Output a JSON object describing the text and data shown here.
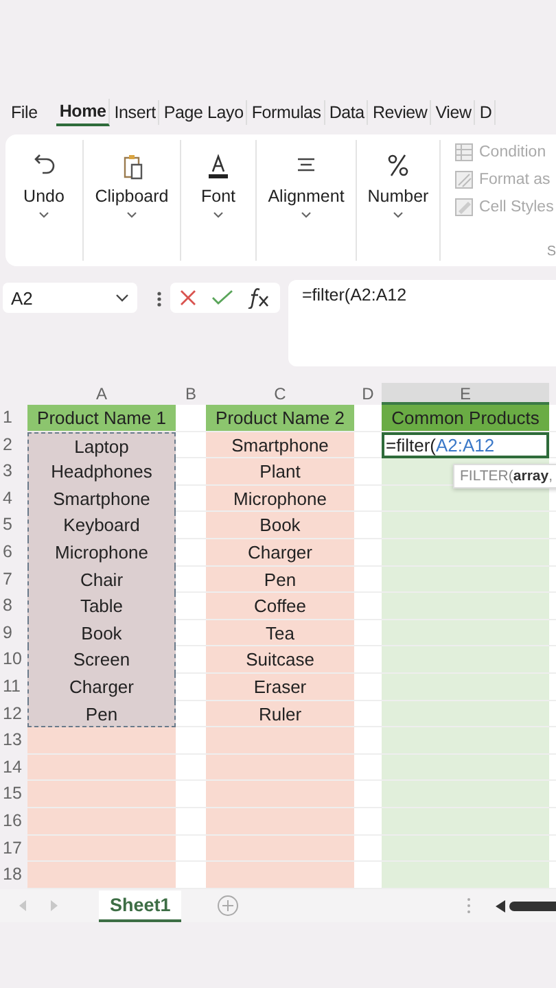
{
  "ribbon_tabs": [
    {
      "label": "File",
      "selected": false
    },
    {
      "label": "Home",
      "selected": true
    },
    {
      "label": "Insert",
      "selected": false
    },
    {
      "label": "Page Layo",
      "selected": false
    },
    {
      "label": "Formulas",
      "selected": false
    },
    {
      "label": "Data",
      "selected": false
    },
    {
      "label": "Review",
      "selected": false
    },
    {
      "label": "View",
      "selected": false
    },
    {
      "label": "D",
      "selected": false
    }
  ],
  "ribbon_groups": [
    {
      "kind": "undo",
      "label": "Undo"
    },
    {
      "kind": "clipboard",
      "label": "Clipboard"
    },
    {
      "kind": "font",
      "label": "Font"
    },
    {
      "kind": "alignment",
      "label": "Alignment"
    },
    {
      "kind": "number",
      "label": "Number"
    }
  ],
  "styles_group": {
    "items": [
      {
        "kind": "conditional",
        "label": "Condition"
      },
      {
        "kind": "table",
        "label": "Format as"
      },
      {
        "kind": "cellstyles",
        "label": "Cell Styles"
      }
    ],
    "group_label": "S"
  },
  "formula_bar": {
    "name_box": "A2",
    "formula": "=filter(A2:A12"
  },
  "sheet": {
    "columns": [
      {
        "letter": "A",
        "kind": "input",
        "selected": false,
        "marquee": true,
        "cells": [
          "Product Name 1",
          "Laptop",
          "Headphones",
          "Smartphone",
          "Keyboard",
          "Microphone",
          "Chair",
          "Table",
          "Book",
          "Screen",
          "Charger",
          "Pen"
        ]
      },
      {
        "letter": "B",
        "kind": "spacer",
        "selected": false
      },
      {
        "letter": "C",
        "kind": "input",
        "selected": false,
        "cells": [
          "Product Name 2",
          "Smartphone",
          "Plant",
          "Microphone",
          "Book",
          "Charger",
          "Pen",
          "Coffee",
          "Tea",
          "Suitcase",
          "Eraser",
          "Ruler"
        ]
      },
      {
        "letter": "D",
        "kind": "spacer",
        "selected": false
      },
      {
        "letter": "E",
        "kind": "output",
        "selected": true,
        "cells": [
          "Common Products"
        ]
      }
    ],
    "rows": [
      "1",
      "2",
      "3",
      "4",
      "5",
      "6",
      "7",
      "8",
      "9",
      "10",
      "11",
      "12",
      "13",
      "14",
      "15",
      "16",
      "17",
      "18"
    ],
    "editing": {
      "prefix": "=filter(",
      "reference": "A2:A12"
    },
    "tooltip": "FILTER(**array**,"
  },
  "sheet_tabs": [
    {
      "label": "Sheet1",
      "selected": true
    }
  ]
}
